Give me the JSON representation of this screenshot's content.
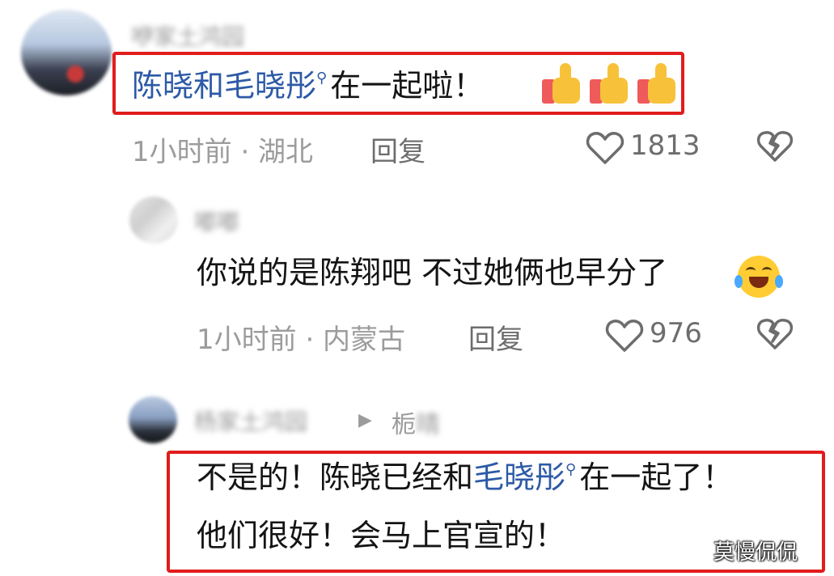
{
  "comments": [
    {
      "username": "咿家土鸿园",
      "text_link": "陈晓和毛晓彤",
      "text_rest": "在一起啦！",
      "meta": "1小时前 · 湖北",
      "reply_label": "回复",
      "likes": "1813"
    },
    {
      "username": "嘟嘟",
      "text": "你说的是陈翔吧 不过她俩也早分了",
      "meta": "1小时前 · 内蒙古",
      "reply_label": "回复",
      "likes": "976"
    },
    {
      "username": "杨家土鸿园",
      "reply_to_name": "栀",
      "reply_to_blur": "晴",
      "line1_before": "不是的！陈晓已经和",
      "line1_link": "毛晓彤",
      "line1_after": "在一起了！",
      "line2": "他们很好！会马上官宣的！"
    }
  ],
  "watermark": "莫慢侃侃",
  "colors": {
    "highlight": "#e21c1c",
    "link": "#2d5aa6",
    "meta": "#9c9c9c"
  },
  "icons": {
    "search": "magnifier-icon",
    "like": "heart-outline-icon",
    "dislike": "broken-heart-icon",
    "thumbs": "thumbs-up-emoji",
    "laugh": "laugh-cry-emoji"
  }
}
